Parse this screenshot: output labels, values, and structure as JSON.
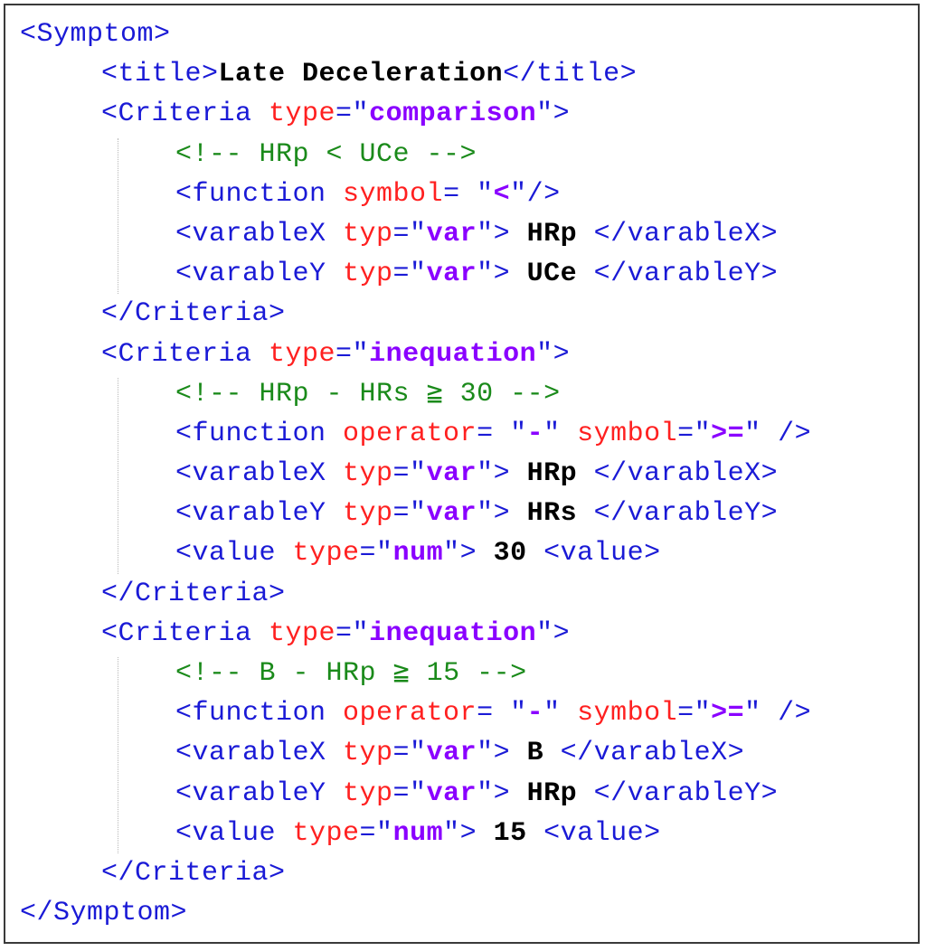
{
  "colors": {
    "tag": "#1a1ad6",
    "attr": "#ff2020",
    "value": "#8a00ff",
    "comment": "#1a8a1a",
    "text": "#000000"
  },
  "lines": [
    {
      "indent": 0,
      "tokens": [
        {
          "t": "<Symptom>",
          "k": "tag"
        }
      ]
    },
    {
      "indent": 1,
      "tokens": [
        {
          "t": "<title>",
          "k": "tag"
        },
        {
          "t": "Late Deceleration",
          "k": "text"
        },
        {
          "t": "</title>",
          "k": "tag"
        }
      ]
    },
    {
      "indent": 1,
      "tokens": [
        {
          "t": "<Criteria ",
          "k": "tag"
        },
        {
          "t": "type",
          "k": "attr"
        },
        {
          "t": "=\"",
          "k": "tag"
        },
        {
          "t": "comparison",
          "k": "value"
        },
        {
          "t": "\">",
          "k": "tag"
        }
      ]
    },
    {
      "indent": 2,
      "tokens": [
        {
          "t": "<!-- HRp < UCe -->",
          "k": "comment"
        }
      ]
    },
    {
      "indent": 2,
      "tokens": [
        {
          "t": "<function ",
          "k": "tag"
        },
        {
          "t": "symbol",
          "k": "attr"
        },
        {
          "t": "= \"",
          "k": "tag"
        },
        {
          "t": "<",
          "k": "value"
        },
        {
          "t": "\"/>",
          "k": "tag"
        }
      ]
    },
    {
      "indent": 2,
      "tokens": [
        {
          "t": "<varableX ",
          "k": "tag"
        },
        {
          "t": "typ",
          "k": "attr"
        },
        {
          "t": "=\"",
          "k": "tag"
        },
        {
          "t": "var",
          "k": "value"
        },
        {
          "t": "\"> ",
          "k": "tag"
        },
        {
          "t": "HRp",
          "k": "text"
        },
        {
          "t": " </varableX>",
          "k": "tag"
        }
      ]
    },
    {
      "indent": 2,
      "tokens": [
        {
          "t": "<varableY ",
          "k": "tag"
        },
        {
          "t": "typ",
          "k": "attr"
        },
        {
          "t": "=\"",
          "k": "tag"
        },
        {
          "t": "var",
          "k": "value"
        },
        {
          "t": "\"> ",
          "k": "tag"
        },
        {
          "t": "UCe",
          "k": "text"
        },
        {
          "t": " </varableY>",
          "k": "tag"
        }
      ]
    },
    {
      "indent": 1,
      "tokens": [
        {
          "t": "</Criteria>",
          "k": "tag"
        }
      ]
    },
    {
      "indent": 1,
      "tokens": [
        {
          "t": "<Criteria ",
          "k": "tag"
        },
        {
          "t": "type",
          "k": "attr"
        },
        {
          "t": "=\"",
          "k": "tag"
        },
        {
          "t": "inequation",
          "k": "value"
        },
        {
          "t": "\">",
          "k": "tag"
        }
      ]
    },
    {
      "indent": 2,
      "tokens": [
        {
          "t": "<!-- HRp - HRs ≧ 30 -->",
          "k": "comment"
        }
      ]
    },
    {
      "indent": 2,
      "tokens": [
        {
          "t": "<function ",
          "k": "tag"
        },
        {
          "t": "operator",
          "k": "attr"
        },
        {
          "t": "= \"",
          "k": "tag"
        },
        {
          "t": "-",
          "k": "value"
        },
        {
          "t": "\" ",
          "k": "tag"
        },
        {
          "t": "symbol",
          "k": "attr"
        },
        {
          "t": "=\"",
          "k": "tag"
        },
        {
          "t": ">=",
          "k": "value"
        },
        {
          "t": "\" />",
          "k": "tag"
        }
      ]
    },
    {
      "indent": 2,
      "tokens": [
        {
          "t": "<varableX ",
          "k": "tag"
        },
        {
          "t": "typ",
          "k": "attr"
        },
        {
          "t": "=\"",
          "k": "tag"
        },
        {
          "t": "var",
          "k": "value"
        },
        {
          "t": "\"> ",
          "k": "tag"
        },
        {
          "t": "HRp",
          "k": "text"
        },
        {
          "t": " </varableX>",
          "k": "tag"
        }
      ]
    },
    {
      "indent": 2,
      "tokens": [
        {
          "t": "<varableY ",
          "k": "tag"
        },
        {
          "t": "typ",
          "k": "attr"
        },
        {
          "t": "=\"",
          "k": "tag"
        },
        {
          "t": "var",
          "k": "value"
        },
        {
          "t": "\"> ",
          "k": "tag"
        },
        {
          "t": "HRs",
          "k": "text"
        },
        {
          "t": " </varableY>",
          "k": "tag"
        }
      ]
    },
    {
      "indent": 2,
      "tokens": [
        {
          "t": "<value ",
          "k": "tag"
        },
        {
          "t": "type",
          "k": "attr"
        },
        {
          "t": "=\"",
          "k": "tag"
        },
        {
          "t": "num",
          "k": "value"
        },
        {
          "t": "\"> ",
          "k": "tag"
        },
        {
          "t": "30",
          "k": "text"
        },
        {
          "t": " <value>",
          "k": "tag"
        }
      ]
    },
    {
      "indent": 1,
      "tokens": [
        {
          "t": "</Criteria>",
          "k": "tag"
        }
      ]
    },
    {
      "indent": 1,
      "tokens": [
        {
          "t": "<Criteria ",
          "k": "tag"
        },
        {
          "t": "type",
          "k": "attr"
        },
        {
          "t": "=\"",
          "k": "tag"
        },
        {
          "t": "inequation",
          "k": "value"
        },
        {
          "t": "\">",
          "k": "tag"
        }
      ]
    },
    {
      "indent": 2,
      "tokens": [
        {
          "t": "<!-- B - HRp ≧ 15 -->",
          "k": "comment"
        }
      ]
    },
    {
      "indent": 2,
      "tokens": [
        {
          "t": "<function ",
          "k": "tag"
        },
        {
          "t": "operator",
          "k": "attr"
        },
        {
          "t": "= \"",
          "k": "tag"
        },
        {
          "t": "-",
          "k": "value"
        },
        {
          "t": "\" ",
          "k": "tag"
        },
        {
          "t": "symbol",
          "k": "attr"
        },
        {
          "t": "=\"",
          "k": "tag"
        },
        {
          "t": ">=",
          "k": "value"
        },
        {
          "t": "\" />",
          "k": "tag"
        }
      ]
    },
    {
      "indent": 2,
      "tokens": [
        {
          "t": "<varableX ",
          "k": "tag"
        },
        {
          "t": "typ",
          "k": "attr"
        },
        {
          "t": "=\"",
          "k": "tag"
        },
        {
          "t": "var",
          "k": "value"
        },
        {
          "t": "\"> ",
          "k": "tag"
        },
        {
          "t": "B",
          "k": "text"
        },
        {
          "t": " </varableX>",
          "k": "tag"
        }
      ]
    },
    {
      "indent": 2,
      "tokens": [
        {
          "t": "<varableY ",
          "k": "tag"
        },
        {
          "t": "typ",
          "k": "attr"
        },
        {
          "t": "=\"",
          "k": "tag"
        },
        {
          "t": "var",
          "k": "value"
        },
        {
          "t": "\"> ",
          "k": "tag"
        },
        {
          "t": "HRp",
          "k": "text"
        },
        {
          "t": " </varableY>",
          "k": "tag"
        }
      ]
    },
    {
      "indent": 2,
      "tokens": [
        {
          "t": "<value ",
          "k": "tag"
        },
        {
          "t": "type",
          "k": "attr"
        },
        {
          "t": "=\"",
          "k": "tag"
        },
        {
          "t": "num",
          "k": "value"
        },
        {
          "t": "\"> ",
          "k": "tag"
        },
        {
          "t": "15",
          "k": "text"
        },
        {
          "t": " <value>",
          "k": "tag"
        }
      ]
    },
    {
      "indent": 1,
      "tokens": [
        {
          "t": "</Criteria>",
          "k": "tag"
        }
      ]
    },
    {
      "indent": 0,
      "tokens": [
        {
          "t": "</Symptom>",
          "k": "tag"
        }
      ]
    }
  ]
}
